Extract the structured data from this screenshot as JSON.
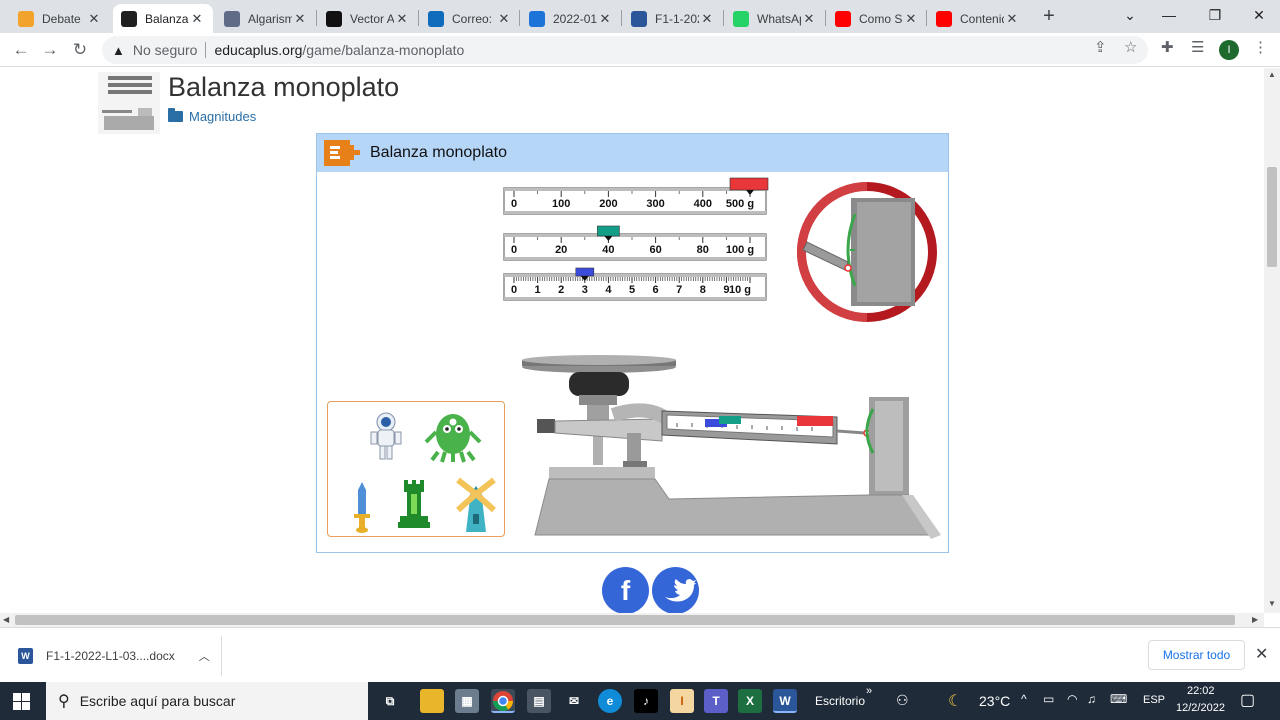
{
  "tabs": [
    {
      "title": "Debate",
      "favicon": "pencil-icon",
      "color": "#f2a32b"
    },
    {
      "title": "Balanza",
      "favicon": "educaplus-icon",
      "color": "#202020",
      "active": true
    },
    {
      "title": "Algarism",
      "favicon": "gear-icon",
      "color": "#5f6b87"
    },
    {
      "title": "Vector A",
      "favicon": "pixel-icon",
      "color": "#111111"
    },
    {
      "title": "Correo: I",
      "favicon": "outlook-icon",
      "color": "#0f6cbd"
    },
    {
      "title": "2022-01",
      "favicon": "onedrive-icon",
      "color": "#1e73d8"
    },
    {
      "title": "F1-1-202",
      "favicon": "word-icon",
      "color": "#2b579a"
    },
    {
      "title": "WhatsAp",
      "favicon": "whatsapp-icon",
      "color": "#25d366"
    },
    {
      "title": "Como Sa",
      "favicon": "youtube-icon",
      "color": "#ff0000"
    },
    {
      "title": "Contenid",
      "favicon": "youtube-icon",
      "color": "#ff0000"
    }
  ],
  "address": {
    "security": "No seguro",
    "host": "educaplus.org",
    "path": "/game/balanza-monoplato"
  },
  "profile_initial": "I",
  "page": {
    "title": "Balanza monoplato",
    "category": "Magnitudes",
    "frame_title": "Balanza monoplato"
  },
  "beams": [
    {
      "labels": [
        "0",
        "100",
        "200",
        "300",
        "400",
        "500 g"
      ],
      "rider_color": "#e8363a",
      "rider_value_g": 500
    },
    {
      "labels": [
        "0",
        "20",
        "40",
        "60",
        "80",
        "100 g"
      ],
      "rider_color": "#139e88",
      "rider_value_g": 40
    },
    {
      "labels": [
        "0",
        "1",
        "2",
        "3",
        "4",
        "5",
        "6",
        "7",
        "8",
        "9",
        "10 g"
      ],
      "rider_color": "#3b4bdc",
      "rider_value_g": 3
    }
  ],
  "objects": [
    "astronaut",
    "alien",
    "sword",
    "chess-rook",
    "windmill"
  ],
  "download": {
    "filename": "F1-1-2022-L1-03....docx",
    "show_all": "Mostrar todo"
  },
  "taskbar": {
    "search_placeholder": "Escribe aquí para buscar",
    "desktop_label": "Escritorio",
    "weather": "23°C",
    "language": "ESP",
    "time": "22:02",
    "date": "12/2/2022"
  }
}
